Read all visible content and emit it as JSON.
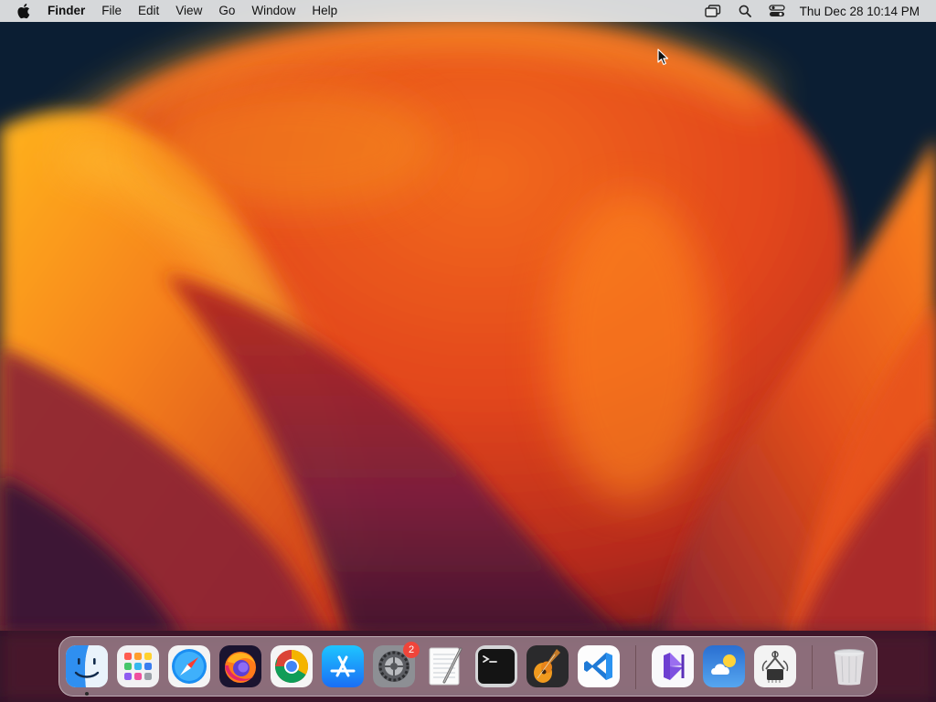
{
  "menubar": {
    "apple_menu": "apple-icon",
    "app_name": "Finder",
    "items": [
      "File",
      "Edit",
      "View",
      "Go",
      "Window",
      "Help"
    ],
    "status_icons": [
      "screen-mirroring-icon",
      "spotlight-search-icon",
      "control-center-icon"
    ],
    "clock": "Thu Dec 28  10:14 PM"
  },
  "dock": {
    "apps": [
      {
        "name": "Finder",
        "icon": "finder-icon",
        "running": true
      },
      {
        "name": "Launchpad",
        "icon": "launchpad-icon",
        "running": false
      },
      {
        "name": "Safari",
        "icon": "safari-icon",
        "running": false
      },
      {
        "name": "Firefox",
        "icon": "firefox-icon",
        "running": false
      },
      {
        "name": "Google Chrome",
        "icon": "chrome-icon",
        "running": false
      },
      {
        "name": "App Store",
        "icon": "app-store-icon",
        "running": false
      },
      {
        "name": "System Settings",
        "icon": "system-settings-icon",
        "running": false,
        "badge": "2"
      },
      {
        "name": "TextEdit",
        "icon": "textedit-icon",
        "running": false
      },
      {
        "name": "Terminal",
        "icon": "terminal-icon",
        "running": false
      },
      {
        "name": "GarageBand",
        "icon": "garageband-icon",
        "running": false
      },
      {
        "name": "Visual Studio Code",
        "icon": "vscode-icon",
        "running": false
      }
    ],
    "recent_apps": [
      {
        "name": "Visual Studio",
        "icon": "visual-studio-icon"
      },
      {
        "name": "Weather",
        "icon": "weather-icon"
      },
      {
        "name": "System Information",
        "icon": "system-information-icon"
      }
    ],
    "trash": {
      "name": "Trash",
      "icon": "trash-icon"
    }
  },
  "wallpaper": {
    "name": "macOS Ventura",
    "colors": [
      "#0b1e33",
      "#e8401a",
      "#ffa21a",
      "#7a1f3d"
    ]
  }
}
